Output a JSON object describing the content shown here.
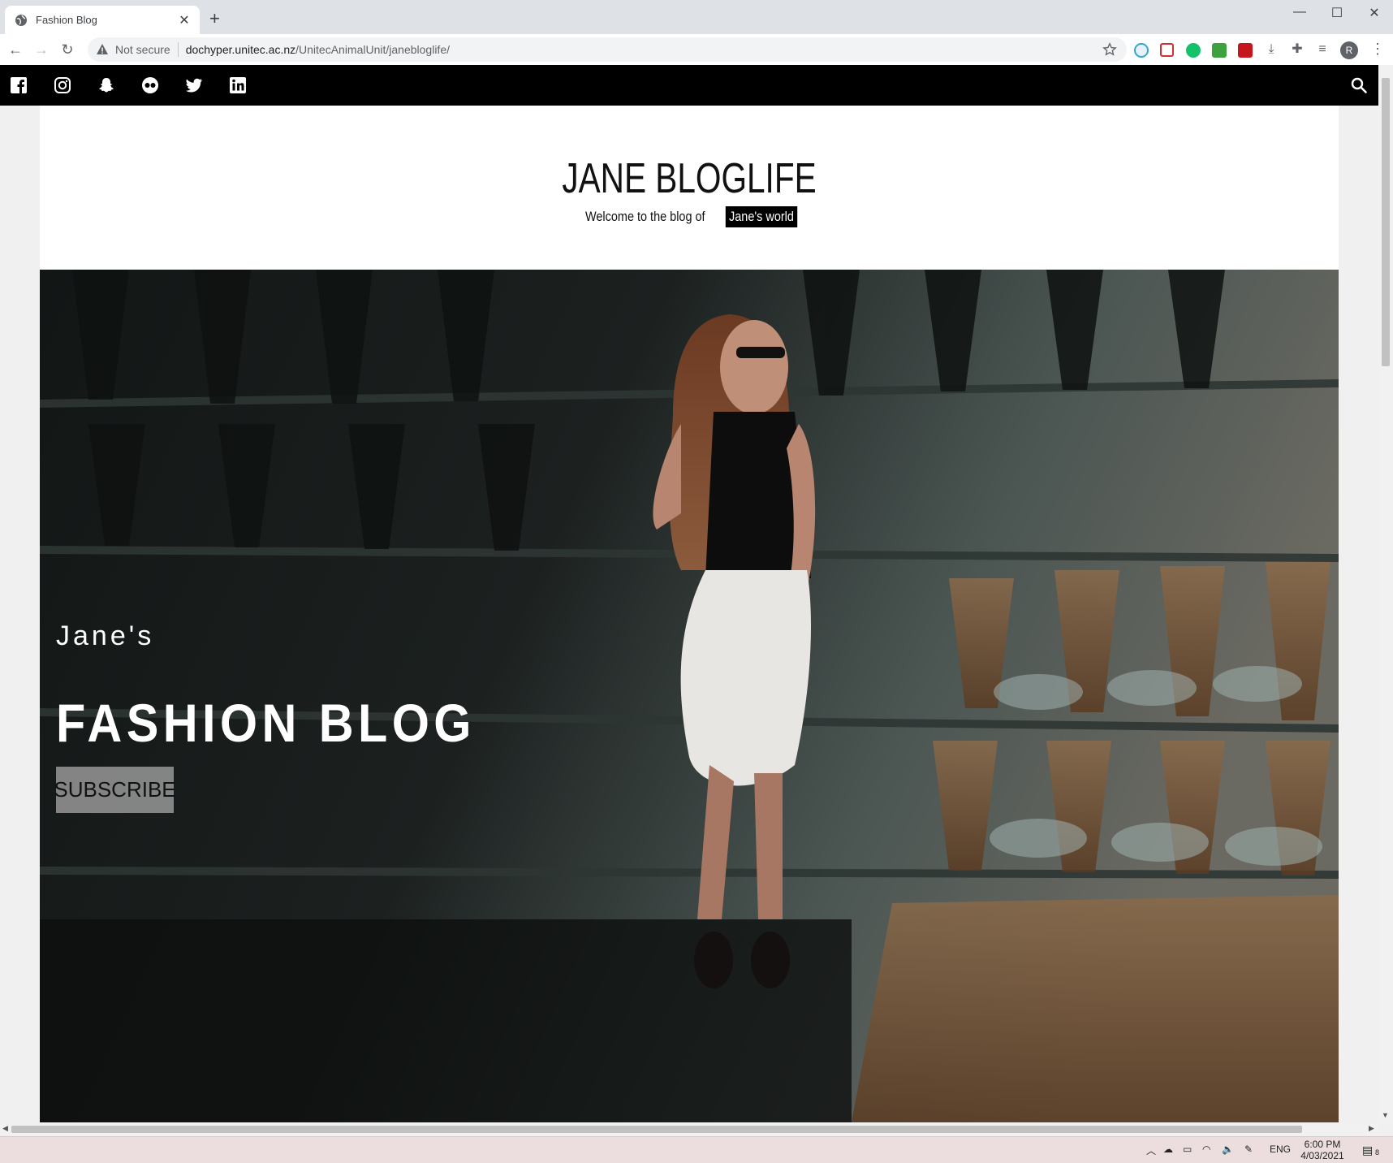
{
  "browser": {
    "tab_title": "Fashion Blog",
    "new_tab": "+",
    "not_secure": "Not secure",
    "url_host": "dochyper.unitec.ac.nz",
    "url_path": "/UnitecAnimalUnit/janebloglife/",
    "profile_initial": "R",
    "window_controls": [
      "—",
      "☐",
      "✕"
    ]
  },
  "social": [
    "facebook",
    "instagram",
    "snapchat",
    "flickr",
    "twitter",
    "linkedin"
  ],
  "site": {
    "title": "JANE BLOGLIFE",
    "tagline_pre": "Welcome to the blog of",
    "tagline_highlight": "Jane's world"
  },
  "hero": {
    "pre_title": "Jane's",
    "title": "FASHION BLOG",
    "button": "SUBSCRIBE"
  },
  "taskbar": {
    "lang": "ENG",
    "time": "6:00 PM",
    "date": "4/03/2021",
    "notification_count": "8"
  },
  "colors": {
    "social_bar": "#000000",
    "accent_highlight": "#000000"
  }
}
